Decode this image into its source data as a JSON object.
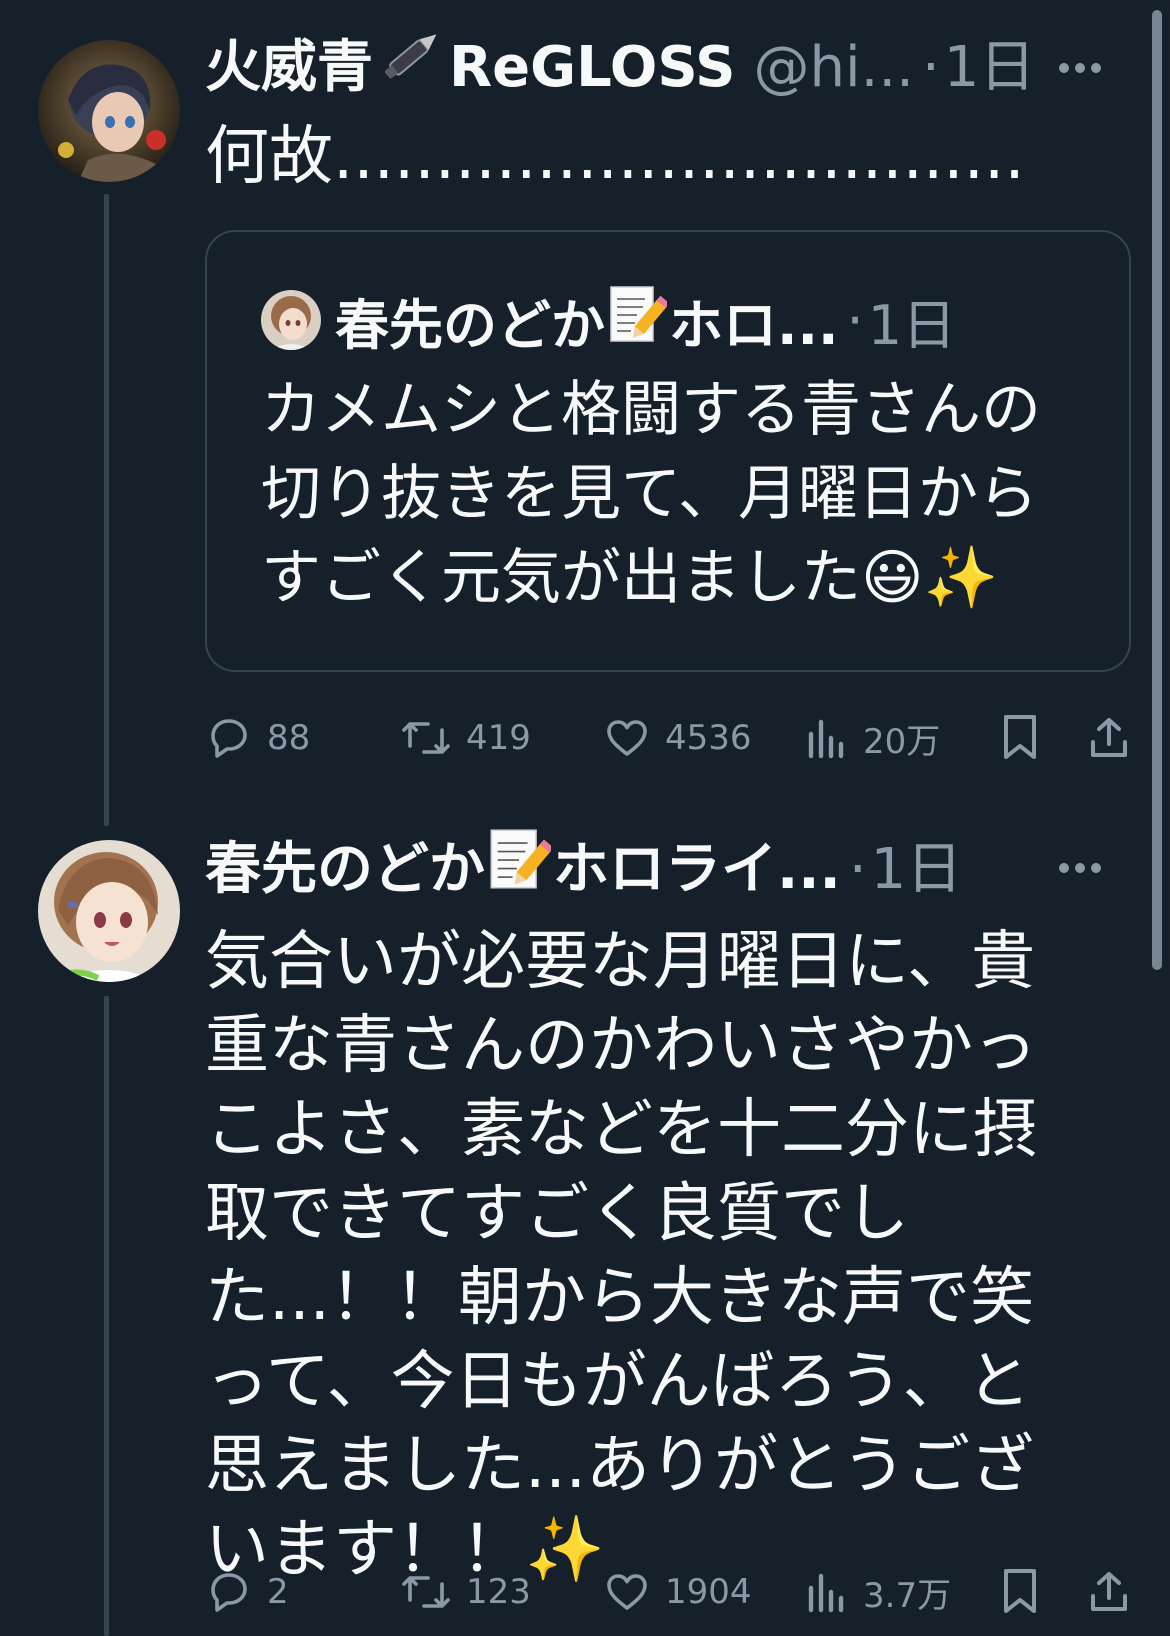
{
  "tweets": [
    {
      "display_name": "火威青",
      "display_name_suffix": "ReGLOSS",
      "handle": "@hi...",
      "dot": "·",
      "time": "1日",
      "text": "何故..................................",
      "avatar_icon": "user-avatar",
      "quote": {
        "display_name": "春先のどか",
        "display_name_suffix": "ホロ...",
        "dot": "·",
        "time": "1日",
        "text": "カメムシと格闘する青さんの切り抜きを見て、月曜日からすごく元気が出ました😃✨"
      },
      "stats": {
        "replies": "88",
        "reposts": "419",
        "likes": "4536",
        "views": "20万"
      }
    },
    {
      "display_name": "春先のどか",
      "display_name_suffix": "ホロライ...",
      "dot": "·",
      "time": "1日",
      "text": "気合いが必要な月曜日に、貴重な青さんのかわいさやかっこよさ、素などを十二分に摂取できてすごく良質でした...！！朝から大きな声で笑って、今日もがんばろう、と思えました...ありがとうございます！！✨",
      "stats": {
        "replies": "2",
        "reposts": "123",
        "likes": "1904",
        "views": "3.7万"
      }
    }
  ],
  "colors": {
    "background": "#15202b",
    "text": "#f7f9f9",
    "secondary": "#8b98a5",
    "border": "#38444d"
  }
}
